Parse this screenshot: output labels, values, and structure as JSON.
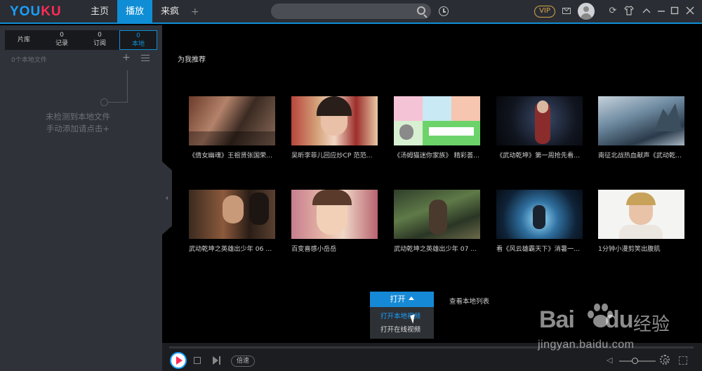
{
  "topbar": {
    "logo": {
      "part1": "YOU",
      "part2": "KU"
    },
    "tabs": [
      {
        "label": "主页"
      },
      {
        "label": "播放"
      },
      {
        "label": "来疯"
      }
    ],
    "add_tab": "+",
    "vip_label": "VIP",
    "search": {
      "value": ""
    },
    "icons": [
      "search-icon",
      "history-icon",
      "mail-icon",
      "avatar",
      "refresh-icon",
      "skin-icon",
      "minimize-icon",
      "maximize-icon",
      "close-icon"
    ]
  },
  "sidebar": {
    "tabs": [
      {
        "label": "片库",
        "count": ""
      },
      {
        "label": "记录",
        "count": "0"
      },
      {
        "label": "订阅",
        "count": "0"
      },
      {
        "label": "本地",
        "count": "0"
      }
    ],
    "file_count": "0个本地文件",
    "add_label": "+",
    "empty_line1": "未检测到本地文件",
    "empty_line2": "手动添加请点击+",
    "collapse_arrow": "‹"
  },
  "main": {
    "section_title": "为我推荐",
    "videos": [
      {
        "title": "《倩女幽魂》王祖贤张国荣..."
      },
      {
        "title": "吴昕李菲儿回应炒CP 范范..."
      },
      {
        "title": "《汤姆猫迷你家族》 精彩荟..."
      },
      {
        "title": "《武动乾坤》第一周抢先看..."
      },
      {
        "title": "南征北战热血献声《武动乾..."
      },
      {
        "title": "武动乾坤之英雄出少年 06 ..."
      },
      {
        "title": "百变喜感小岳岳"
      },
      {
        "title": "武动乾坤之英雄出少年 07 ..."
      },
      {
        "title": "看《风云雄霸天下》消暑一..."
      },
      {
        "title": "1分钟小漫剪笑出腹肌"
      }
    ],
    "open_button": "打开",
    "open_menu": [
      "打开本地视频",
      "打开在线视频"
    ],
    "local_list_link": "查看本地列表"
  },
  "player": {
    "speed_label": "倍速"
  },
  "watermark": {
    "brand_latin": "Bai",
    "brand_latin2": "du",
    "brand_cn": "经验",
    "url": "jingyan.baidu.com"
  },
  "colors": {
    "accent": "#0f8ed6",
    "logo_blue": "#1aa0ff",
    "logo_red": "#ff2a56",
    "vip_gold": "#d9a44a"
  }
}
